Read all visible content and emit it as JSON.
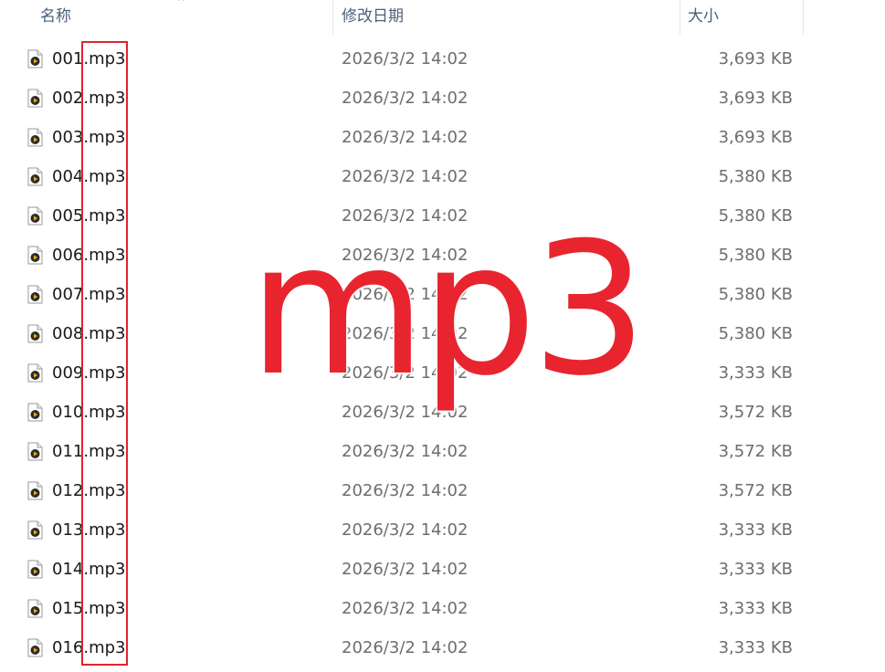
{
  "columns": {
    "name": "名称",
    "modified": "修改日期",
    "size": "大小"
  },
  "sort_indicator": "^",
  "file_icon": "media-file-icon",
  "files": [
    {
      "name": "001.mp3",
      "modified": "2026/3/2 14:02",
      "size": "3,693 KB"
    },
    {
      "name": "002.mp3",
      "modified": "2026/3/2 14:02",
      "size": "3,693 KB"
    },
    {
      "name": "003.mp3",
      "modified": "2026/3/2 14:02",
      "size": "3,693 KB"
    },
    {
      "name": "004.mp3",
      "modified": "2026/3/2 14:02",
      "size": "5,380 KB"
    },
    {
      "name": "005.mp3",
      "modified": "2026/3/2 14:02",
      "size": "5,380 KB"
    },
    {
      "name": "006.mp3",
      "modified": "2026/3/2 14:02",
      "size": "5,380 KB"
    },
    {
      "name": "007.mp3",
      "modified": "2026/3/2 14:02",
      "size": "5,380 KB"
    },
    {
      "name": "008.mp3",
      "modified": "2026/3/2 14:02",
      "size": "5,380 KB"
    },
    {
      "name": "009.mp3",
      "modified": "2026/3/2 14:02",
      "size": "3,333 KB"
    },
    {
      "name": "010.mp3",
      "modified": "2026/3/2 14:02",
      "size": "3,572 KB"
    },
    {
      "name": "011.mp3",
      "modified": "2026/3/2 14:02",
      "size": "3,572 KB"
    },
    {
      "name": "012.mp3",
      "modified": "2026/3/2 14:02",
      "size": "3,572 KB"
    },
    {
      "name": "013.mp3",
      "modified": "2026/3/2 14:02",
      "size": "3,333 KB"
    },
    {
      "name": "014.mp3",
      "modified": "2026/3/2 14:02",
      "size": "3,333 KB"
    },
    {
      "name": "015.mp3",
      "modified": "2026/3/2 14:02",
      "size": "3,333 KB"
    },
    {
      "name": "016.mp3",
      "modified": "2026/3/2 14:02",
      "size": "3,333 KB"
    }
  ],
  "annotation": {
    "overlay_text": "mp3",
    "highlight_color": "#e0242e",
    "overlay_color": "#e8252f"
  }
}
